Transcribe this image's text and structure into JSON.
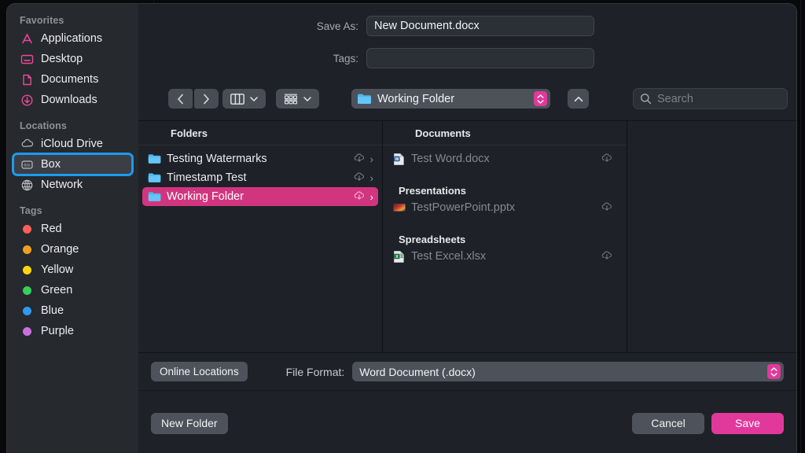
{
  "window": {
    "title": "Save As dialog"
  },
  "sidebar": {
    "groups": [
      {
        "title": "Favorites",
        "items": [
          {
            "label": "Applications",
            "icon": "applications-icon"
          },
          {
            "label": "Desktop",
            "icon": "desktop-icon"
          },
          {
            "label": "Documents",
            "icon": "documents-icon"
          },
          {
            "label": "Downloads",
            "icon": "downloads-icon"
          }
        ]
      },
      {
        "title": "Locations",
        "items": [
          {
            "label": "iCloud Drive",
            "icon": "icloud-icon"
          },
          {
            "label": "Box",
            "icon": "box-icon",
            "selected": true
          },
          {
            "label": "Network",
            "icon": "network-icon"
          }
        ]
      },
      {
        "title": "Tags",
        "items": [
          {
            "label": "Red",
            "icon": "tag-dot-icon",
            "color": "#ff5f57"
          },
          {
            "label": "Orange",
            "icon": "tag-dot-icon",
            "color": "#f0a01e"
          },
          {
            "label": "Yellow",
            "icon": "tag-dot-icon",
            "color": "#ffd60a"
          },
          {
            "label": "Green",
            "icon": "tag-dot-icon",
            "color": "#34d058"
          },
          {
            "label": "Blue",
            "icon": "tag-dot-icon",
            "color": "#2b9bf4"
          },
          {
            "label": "Purple",
            "icon": "tag-dot-icon",
            "color": "#cc6ee0"
          }
        ]
      }
    ]
  },
  "form": {
    "save_as_label": "Save As:",
    "save_as_value": "New Document.docx",
    "tags_label": "Tags:",
    "tags_value": "",
    "tags_placeholder": ""
  },
  "toolbar": {
    "back_icon": "chevron-left-icon",
    "forward_icon": "chevron-right-icon",
    "view_column_icon": "column-view-icon",
    "view_group_icon": "group-by-icon",
    "path_label": "Working Folder",
    "path_icon": "folder-icon",
    "up_icon": "chevron-up-icon",
    "search_icon": "search-icon",
    "search_placeholder": "Search",
    "search_value": ""
  },
  "browser": {
    "columns": [
      {
        "header": "Folders",
        "rows": [
          {
            "name": "Testing Watermarks",
            "icon": "folder-icon",
            "cloud": "cloud-download-icon",
            "chevron": "›",
            "selected": false
          },
          {
            "name": "Timestamp Test",
            "icon": "folder-icon",
            "cloud": "cloud-download-icon",
            "chevron": "›",
            "selected": false
          },
          {
            "name": "Working Folder",
            "icon": "folder-icon",
            "cloud": "cloud-download-icon",
            "chevron": "›",
            "selected": true
          }
        ]
      },
      {
        "header": "Documents",
        "groups": [
          {
            "title": "",
            "rows": [
              {
                "name": "Test Word.docx",
                "icon": "word-file-icon",
                "cloud": "cloud-download-icon",
                "disabled": true
              }
            ]
          },
          {
            "title": "Presentations",
            "rows": [
              {
                "name": "TestPowerPoint.pptx",
                "icon": "powerpoint-file-icon",
                "cloud": "cloud-download-icon",
                "disabled": true
              }
            ]
          },
          {
            "title": "Spreadsheets",
            "rows": [
              {
                "name": "Test Excel.xlsx",
                "icon": "excel-file-icon",
                "cloud": "cloud-download-icon",
                "disabled": true
              }
            ]
          }
        ]
      }
    ]
  },
  "footer": {
    "online_locations_label": "Online Locations",
    "file_format_label": "File Format:",
    "file_format_value": "Word Document (.docx)",
    "new_folder_label": "New Folder",
    "cancel_label": "Cancel",
    "save_label": "Save"
  },
  "colors": {
    "accent_pink": "#e0399b",
    "selection_pink": "#d2357f",
    "focus_blue": "#1b9bf0",
    "folder_blue": "#4db8f0"
  }
}
